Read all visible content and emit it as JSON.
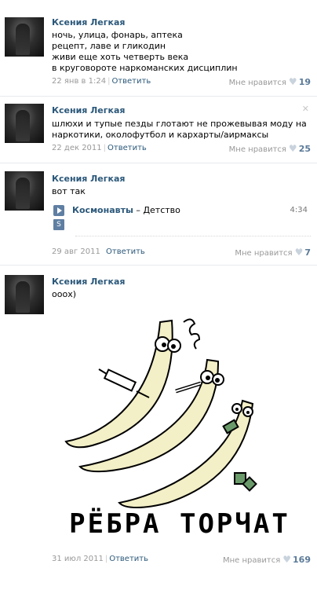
{
  "posts": [
    {
      "author": "Ксения Легкая",
      "lines": [
        "ночь, улица, фонарь, аптека",
        "рецепт, лаве и гликодин",
        "живи еще хоть четверть века",
        "в круговороте наркоманских дисциплин"
      ],
      "date": "22 янв в 1:24",
      "reply": "Ответить",
      "like_label": "Мне нравится",
      "likes": "19"
    },
    {
      "author": "Ксения Легкая",
      "lines": [
        "шлюхи и тупые пезды глотают не прожевывая моду на",
        "наркотики, околофутбол и кархарты/аирмаксы"
      ],
      "date": "22 дек 2011",
      "reply": "Ответить",
      "like_label": "Мне нравится",
      "likes": "25",
      "close": "✕"
    },
    {
      "author": "Ксения Легкая",
      "lines": [
        "вот так"
      ],
      "audio": {
        "artist": "Космонавты",
        "dash": " – ",
        "title": "Детство",
        "duration": "4:34",
        "s_label": "S"
      },
      "date": "29 авг 2011",
      "reply": "Ответить",
      "like_label": "Мне нравится",
      "likes": "7"
    },
    {
      "author": "Ксения Легкая",
      "lines": [
        "ооох)"
      ],
      "image_caption": "РЁБРА ТОРЧАТ",
      "date": "31 июл 2011",
      "reply": "Ответить",
      "like_label": "Мне нравится",
      "likes": "169"
    }
  ]
}
